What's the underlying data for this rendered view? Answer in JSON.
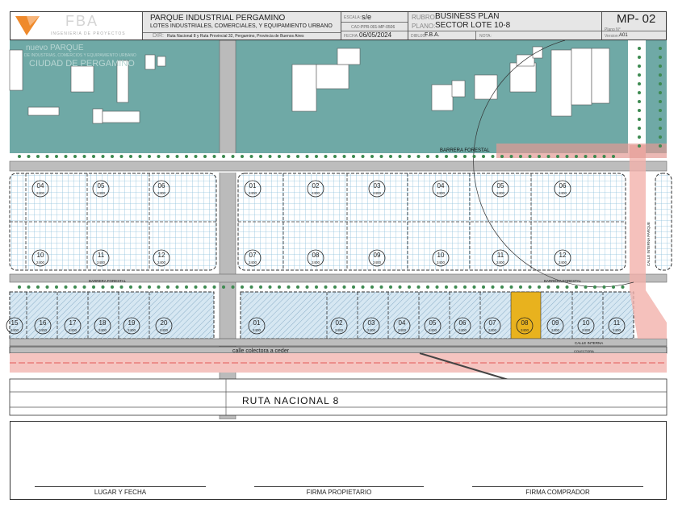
{
  "header": {
    "logo_text": "FBA",
    "logo_subtitle": "INGENIERIA DE PROYECTOS",
    "title": "PARQUE INDUSTRIAL PERGAMINO",
    "subtitle": "LOTES INDUSTRIALES, COMERCIALES, Y EQUIPAMIENTO URBANO",
    "dir_label": "DIR:",
    "dir_value": "Ruta Nacional 8 y Ruta Provincial 32, Pergamino, Provincia de Buenos Aires",
    "escala_label": "ESCALA:",
    "escala_value": "s/e",
    "cad_label": "CAD:",
    "cad_value": "PPR-001-MP-0506",
    "fecha_label": "FECHA:",
    "fecha_value": "06/05/2024",
    "rubro_label": "RUBRO:",
    "rubro_value": "BUSINESS PLAN",
    "plano_label": "PLANO:",
    "plano_value": "SECTOR LOTE 10-8",
    "dibujo_label": "DIBUJO:",
    "dibujo_value": "F.B.A.",
    "nota_label": "NOTA:",
    "sheet_code": "MP- 02",
    "plano_n_label": "Plano N°",
    "version_label": "Version:",
    "version_value": "A01"
  },
  "map": {
    "watermark_line1": "nuevo PARQUE",
    "watermark_line2": "DE INDUSTRIAS, COMERCIOS Y EQUIPAMIENTO URBANO",
    "watermark_line3": "CIUDAD DE PERGAMINO",
    "barrera_forestal": "BARRERA FORESTAL",
    "calle_interna": "CALLE INTERNA",
    "calle_interna_parque": "CALLE INTERNA PARQUE",
    "calle_colectora": "calle colectora a ceder",
    "colectora": "COLECTORA",
    "ruta": "RUTA NACIONAL 8",
    "lots_top_left": [
      "04",
      "05",
      "06"
    ],
    "lots_mid_left": [
      "10",
      "11",
      "12"
    ],
    "lots_top_right": [
      "01",
      "02",
      "03",
      "04",
      "05",
      "06"
    ],
    "lots_mid_right": [
      "07",
      "08",
      "09",
      "10",
      "11",
      "12"
    ],
    "lots_bottom_left": [
      "15",
      "16",
      "17",
      "18",
      "19",
      "20"
    ],
    "lots_bottom_right": [
      "01",
      "02",
      "03",
      "04",
      "05",
      "06",
      "07",
      "08",
      "09",
      "10",
      "11"
    ],
    "lot_area": "2400",
    "highlighted_lot": "08",
    "highlight_color": "#e8b21e",
    "teal_color": "#6fa9a6"
  },
  "signatures": {
    "place_date": "LUGAR Y FECHA",
    "owner": "FIRMA PROPIETARIO",
    "buyer": "FIRMA COMPRADOR"
  }
}
